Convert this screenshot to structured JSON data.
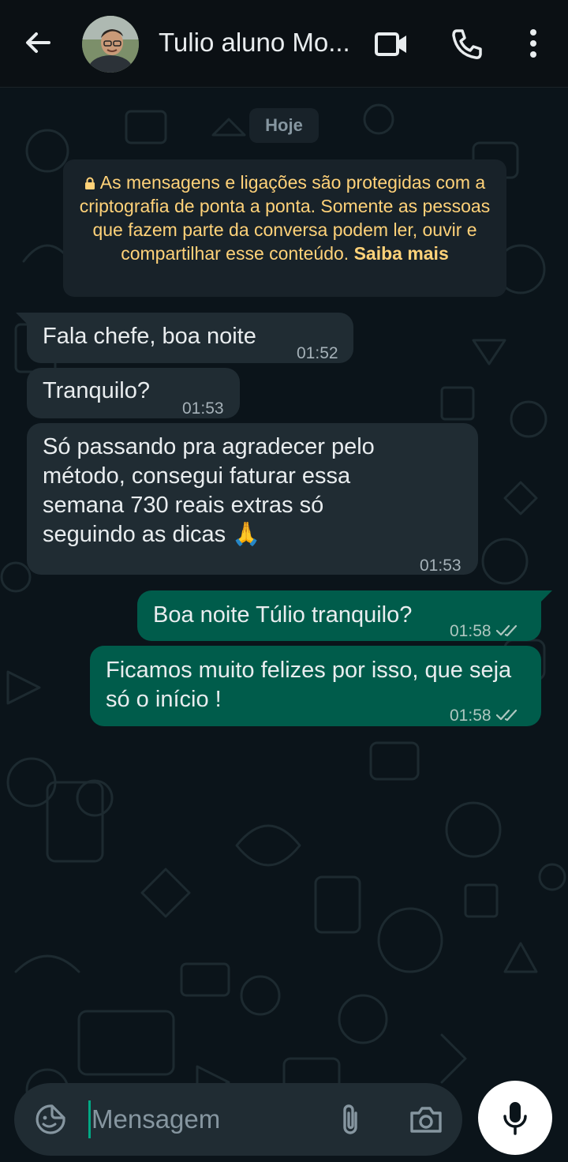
{
  "header": {
    "contact_name": "Tulio aluno Mo...",
    "icons": [
      "back-arrow-icon",
      "video-call-icon",
      "voice-call-icon",
      "more-options-icon"
    ]
  },
  "chat": {
    "day_label": "Hoje",
    "encryption_notice": {
      "text": "As mensagens e ligações são protegidas com a criptografia de ponta a ponta. Somente as pessoas que fazem parte da conversa podem ler, ouvir e compartilhar esse conteúdo.",
      "link": "Saiba mais",
      "icon": "lock-icon"
    },
    "messages": [
      {
        "direction": "incoming",
        "text": "Fala chefe, boa noite",
        "time": "01:52"
      },
      {
        "direction": "incoming",
        "text": "Tranquilo?",
        "time": "01:53"
      },
      {
        "direction": "incoming",
        "text": "Só passando pra agradecer pelo método, consegui faturar essa semana 730 reais extras só seguindo as dicas 🙏",
        "time": "01:53"
      },
      {
        "direction": "outgoing",
        "text": "Boa noite Túlio tranquilo?",
        "time": "01:58",
        "status": "read"
      },
      {
        "direction": "outgoing",
        "text": "Ficamos muito felizes por isso, que seja só o início !",
        "time": "01:58",
        "status": "read"
      }
    ]
  },
  "composer": {
    "placeholder": "Mensagem",
    "value": "",
    "icons": [
      "emoji-icon",
      "attach-icon",
      "camera-icon",
      "mic-icon"
    ]
  },
  "colors": {
    "background": "#0b141a",
    "incoming_bubble": "#202c33",
    "outgoing_bubble": "#005c4b",
    "notice_text": "#ffd279",
    "accent": "#00a884"
  }
}
